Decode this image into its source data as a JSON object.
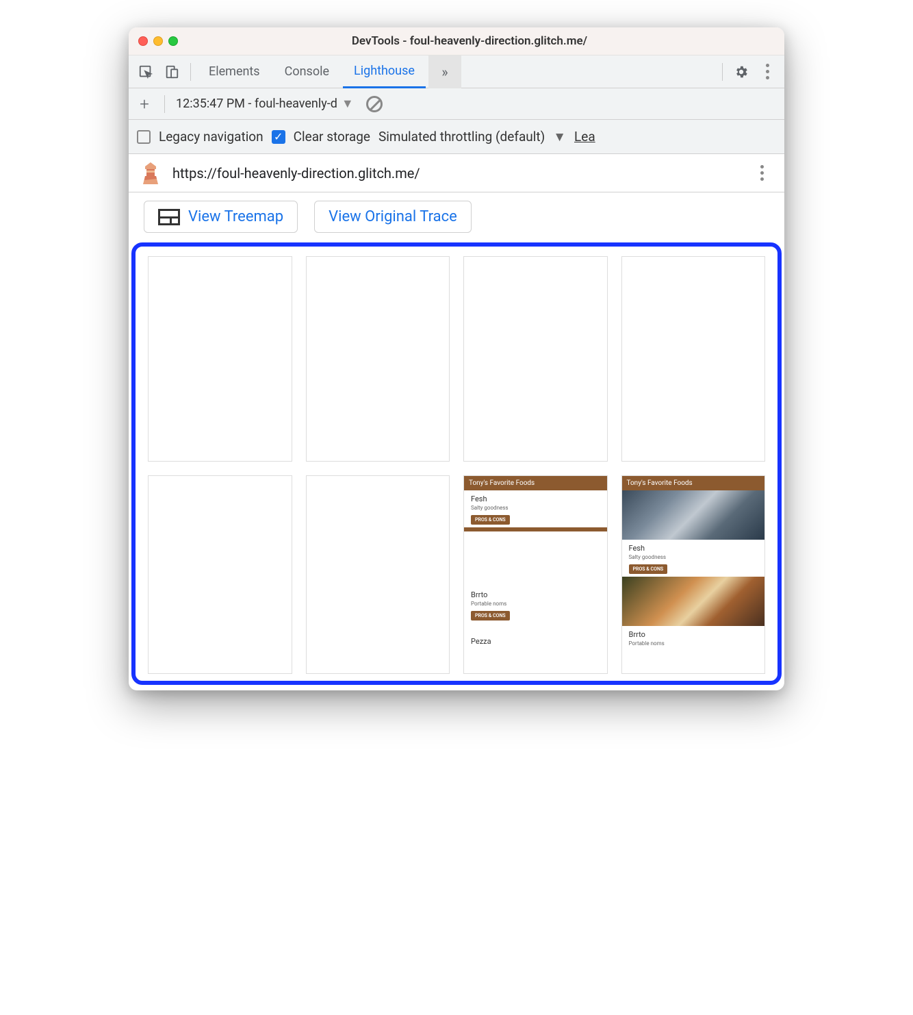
{
  "window": {
    "title": "DevTools - foul-heavenly-direction.glitch.me/"
  },
  "tabs": {
    "elements": "Elements",
    "console": "Console",
    "lighthouse": "Lighthouse"
  },
  "actionbar": {
    "report_label": "12:35:47 PM - foul-heavenly-d"
  },
  "filterbar": {
    "legacy_label": "Legacy navigation",
    "clear_label": "Clear storage",
    "throttle_label": "Simulated throttling (default)",
    "learn_label": "Lea"
  },
  "url": "https://foul-heavenly-direction.glitch.me/",
  "buttons": {
    "treemap": "View Treemap",
    "trace": "View Original Trace"
  },
  "filmstrip": {
    "header": "Tony's Favorite Foods",
    "items": [
      {
        "title": "Fesh",
        "sub": "Salty goodness",
        "btn": "PROS & CONS"
      },
      {
        "title": "Brrto",
        "sub": "Portable noms",
        "btn": "PROS & CONS"
      },
      {
        "title": "Pezza",
        "sub": "",
        "btn": ""
      }
    ]
  }
}
